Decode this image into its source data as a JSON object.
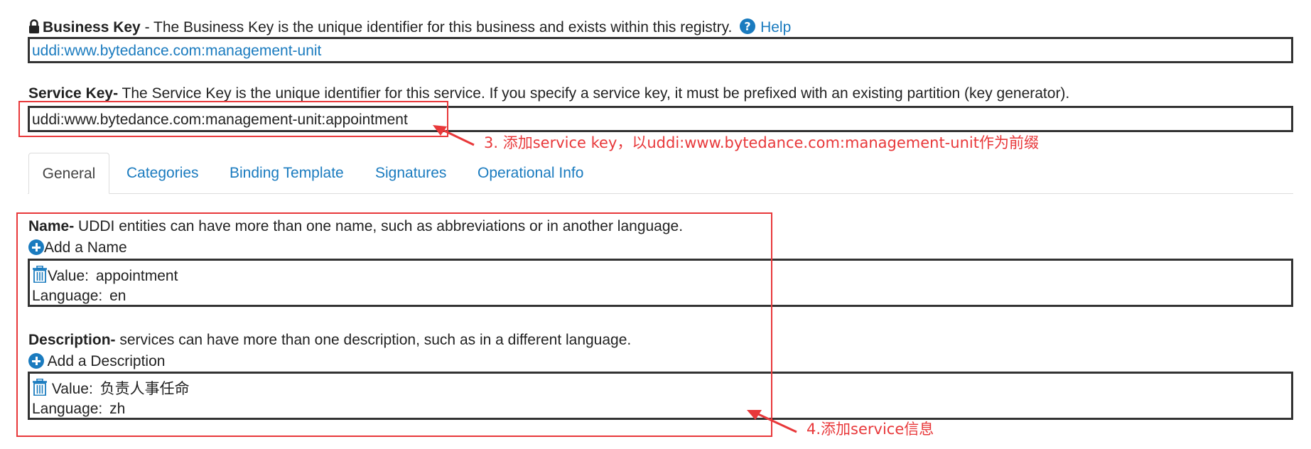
{
  "business_key": {
    "label": "Business Key",
    "separator": " - ",
    "description": "The Business Key is the unique identifier for this business and exists within this registry.",
    "help_label": "Help",
    "value": "uddi:www.bytedance.com:management-unit"
  },
  "service_key": {
    "label": "Service Key",
    "separator": "-",
    "description": " The Service Key is the unique identifier for this service. If you specify a service key, it must be prefixed with an existing partition (key generator).",
    "value": "uddi:www.bytedance.com:management-unit:appointment"
  },
  "annotations": {
    "step3": "3. 添加service key，以uddi:www.bytedance.com:management-unit作为前缀",
    "step4": "4.添加service信息"
  },
  "tabs": [
    {
      "label": "General",
      "active": true
    },
    {
      "label": "Categories",
      "active": false
    },
    {
      "label": "Binding Template",
      "active": false
    },
    {
      "label": "Signatures",
      "active": false
    },
    {
      "label": "Operational Info",
      "active": false
    }
  ],
  "name_section": {
    "label": "Name-",
    "description": " UDDI entities can have more than one name, such as abbreviations or in another language.",
    "add_label": "Add a Name",
    "value_label": "Value:",
    "value": "appointment",
    "language_label": "Language:",
    "language": "en"
  },
  "description_section": {
    "label": "Description-",
    "description": " services can have more than one description, such as in a different language.",
    "add_label": " Add a Description",
    "value_label": " Value:",
    "value": "负责人事任命",
    "language_label": "Language:",
    "language": "zh"
  },
  "colors": {
    "link": "#1a7bbf",
    "annotation": "#e8383a",
    "border": "#333333"
  }
}
